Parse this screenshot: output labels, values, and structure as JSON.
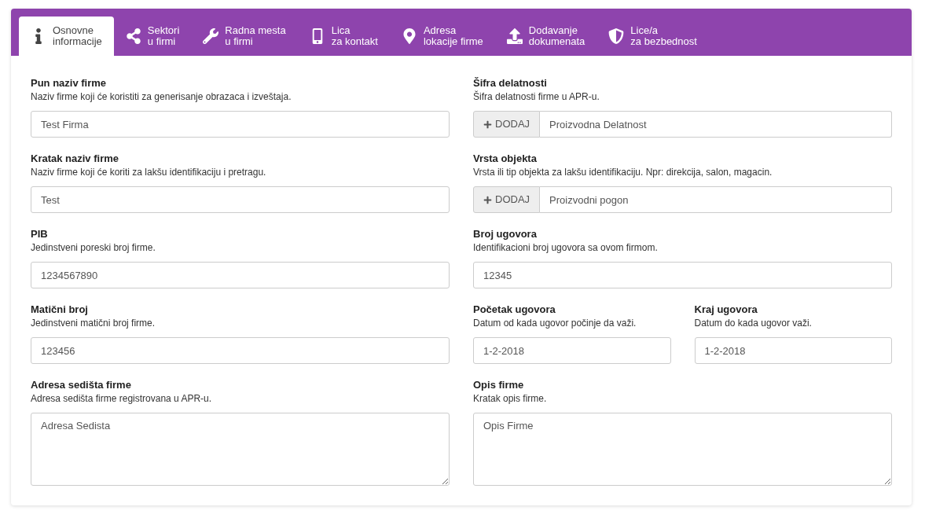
{
  "tabs": [
    {
      "lines": [
        "Osnovne",
        "informacije"
      ],
      "selected": true
    },
    {
      "lines": [
        "Sektori",
        "u firmi"
      ],
      "selected": false
    },
    {
      "lines": [
        "Radna mesta",
        "u firmi"
      ],
      "selected": false
    },
    {
      "lines": [
        "Lica",
        "za kontakt"
      ],
      "selected": false
    },
    {
      "lines": [
        "Adresa",
        "lokacije firme"
      ],
      "selected": false
    },
    {
      "lines": [
        "Dodavanje",
        "dokumenata"
      ],
      "selected": false
    },
    {
      "lines": [
        "Lice/a",
        "za bezbednost"
      ],
      "selected": false
    }
  ],
  "fields": [
    {
      "kind": "input",
      "label": "Pun naziv firme",
      "help": "Naziv firme koji će koristiti za generisanje obrazaca i izveštaja.",
      "value": "Test Firma"
    },
    {
      "kind": "addon",
      "label": "Šifra delatnosti",
      "help": "Šifra delatnosti firme u APR-u.",
      "button": "DODAJ",
      "value": "Proizvodna Delatnost"
    },
    {
      "kind": "input",
      "label": "Kratak naziv firme",
      "help": "Naziv firme koji će koriti za lakšu identifikaciju i pretragu.",
      "value": "Test"
    },
    {
      "kind": "addon",
      "label": "Vrsta objekta",
      "help": "Vrsta ili tip objekta za lakšu identifikaciju. Npr: direkcija, salon, magacin.",
      "button": "DODAJ",
      "value": "Proizvodni pogon"
    },
    {
      "kind": "input",
      "label": "PIB",
      "help": "Jedinstveni poreski broj firme.",
      "value": "1234567890"
    },
    {
      "kind": "input",
      "label": "Broj ugovora",
      "help": "Identifikacioni broj ugovora sa ovom firmom.",
      "value": "12345"
    },
    {
      "kind": "input",
      "label": "Matični broj",
      "help": "Jedinstveni matični broj firme.",
      "value": "123456"
    },
    {
      "kind": "split",
      "parts": [
        {
          "label": "Početak ugovora",
          "help": "Datum od kada ugovor počinje da važi.",
          "value": "1-2-2018"
        },
        {
          "label": "Kraj ugovora",
          "help": "Datum do kada ugovor važi.",
          "value": "1-2-2018"
        }
      ]
    },
    {
      "kind": "textarea",
      "label": "Adresa sedišta firme",
      "help": "Adresa sedišta firme registrovana u APR-u.",
      "value": "Adresa Sedista"
    },
    {
      "kind": "textarea",
      "label": "Opis firme",
      "help": "Kratak opis firme.",
      "value": "Opis Firme"
    }
  ]
}
